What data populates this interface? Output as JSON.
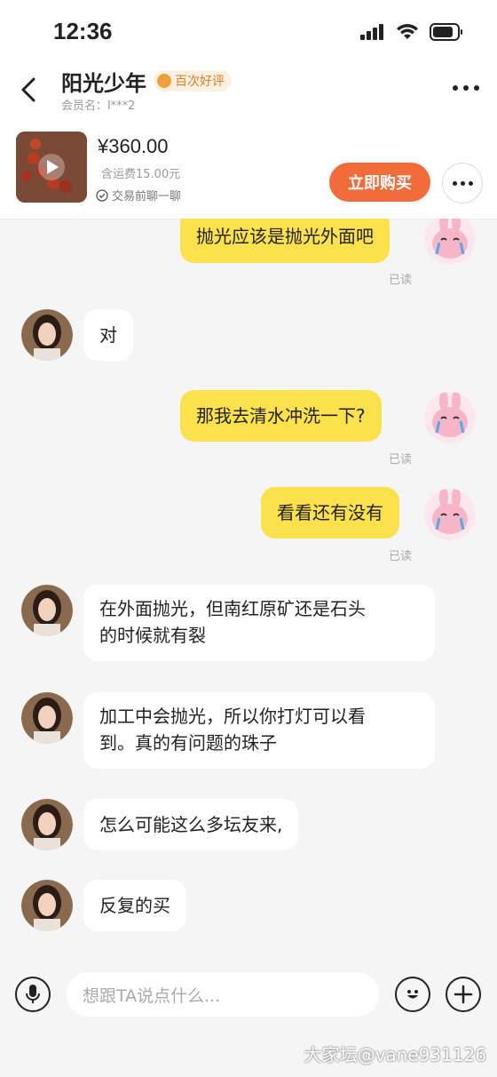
{
  "status_bar": {
    "time": "12:36"
  },
  "header": {
    "title": "阳光少年",
    "badge": "百次好评",
    "member": "会员名：l***2"
  },
  "product": {
    "price": "¥360.00",
    "shipping": "含运费15.00元",
    "chat_tip": "交易前聊一聊",
    "buy_label": "立即购买"
  },
  "messages": [
    {
      "side": "me",
      "text": "抛光应该是抛光外面吧",
      "read": "已读"
    },
    {
      "side": "them",
      "text": "对"
    },
    {
      "side": "me",
      "text": "那我去清水冲洗一下?",
      "read": "已读"
    },
    {
      "side": "me",
      "text": "看看还有没有",
      "read": "已读"
    },
    {
      "side": "them",
      "lines": [
        "在外面抛光，但南红原矿还是石头",
        "的时候就有裂"
      ]
    },
    {
      "side": "them",
      "lines": [
        "加工中会抛光，所以你打灯可以看",
        "到。真的有问题的珠子"
      ]
    },
    {
      "side": "them",
      "text": "怎么可能这么多坛友来,"
    },
    {
      "side": "them",
      "text": "反复的买"
    }
  ],
  "input": {
    "placeholder": "想跟TA说点什么..."
  },
  "watermark": "大家坛@vane931126",
  "colors": {
    "accent": "#f26b3a",
    "my_bubble": "#fbe14b",
    "background": "#f5f5f5"
  }
}
